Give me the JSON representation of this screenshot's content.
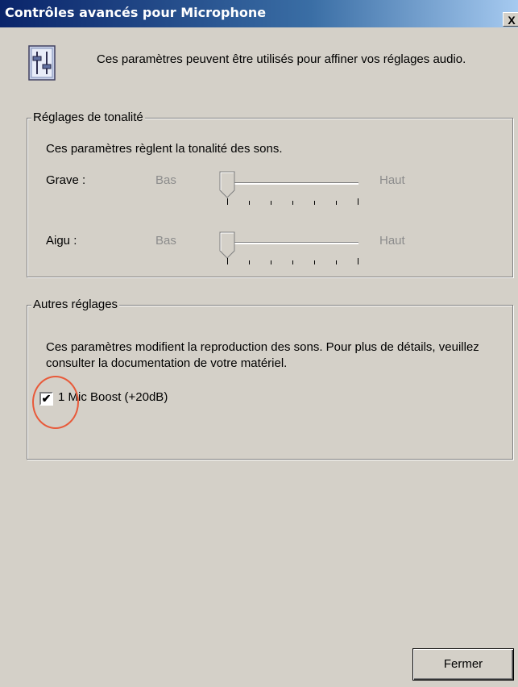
{
  "window": {
    "title": "Contrôles avancés pour Microphone",
    "close_glyph": "X"
  },
  "header": {
    "description": "Ces paramètres peuvent être utilisés pour affiner vos réglages audio.",
    "icon": "mixer-sliders-icon"
  },
  "tone_group": {
    "title": "Réglages de tonalité",
    "description": "Ces paramètres règlent la tonalité des sons.",
    "sliders": [
      {
        "label": "Grave :",
        "min_label": "Bas",
        "max_label": "Haut",
        "value": 0
      },
      {
        "label": "Aigu :",
        "min_label": "Bas",
        "max_label": "Haut",
        "value": 0
      }
    ]
  },
  "other_group": {
    "title": "Autres réglages",
    "description": "Ces paramètres modifient la reproduction des sons. Pour plus de détails, veuillez consulter la documentation de votre matériel.",
    "checkbox": {
      "label": "1 Mic Boost (+20dB)",
      "checked": true,
      "check_glyph": "✔"
    }
  },
  "footer": {
    "close_button": "Fermer"
  },
  "colors": {
    "titlebar_start": "#0a246a",
    "titlebar_end": "#a6caf0",
    "dialog_bg": "#d4d0c8",
    "annotation_circle": "#e85a3a"
  }
}
